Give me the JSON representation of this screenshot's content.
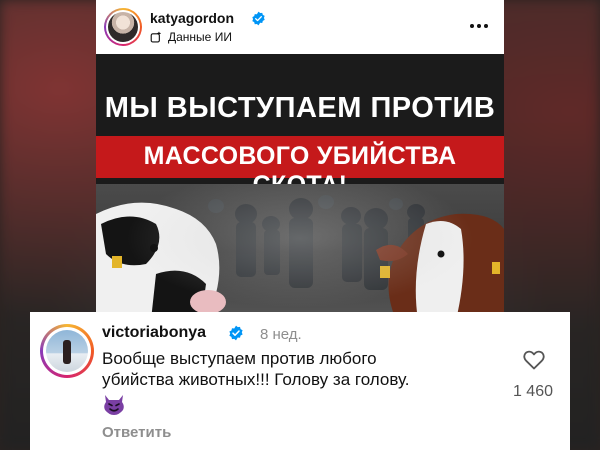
{
  "post": {
    "username": "katyagordon",
    "ai_label": "Данные ИИ",
    "image_headline_line1": "МЫ ВЫСТУПАЕМ ПРОТИВ",
    "image_headline_line2": "МАССОВОГО УБИЙСТВА СКОТА!"
  },
  "comment": {
    "username": "victoriabonya",
    "time": "8 нед.",
    "text": "Вообще выступаем против любого убийства животных!!! Голову за голову.",
    "like_count": "1 460",
    "reply_label": "Ответить"
  },
  "icons": {
    "verified": "verified-badge-icon",
    "ai": "ai-info-icon",
    "more": "more-dots-icon",
    "like": "heart-outline-icon",
    "emoji": "smiling-imp-emoji"
  },
  "colors": {
    "verified_blue": "#0095f6",
    "banner_red": "#c5191b",
    "emoji_purple": "#7a3fa3",
    "meta_gray": "#8e8e8e"
  }
}
